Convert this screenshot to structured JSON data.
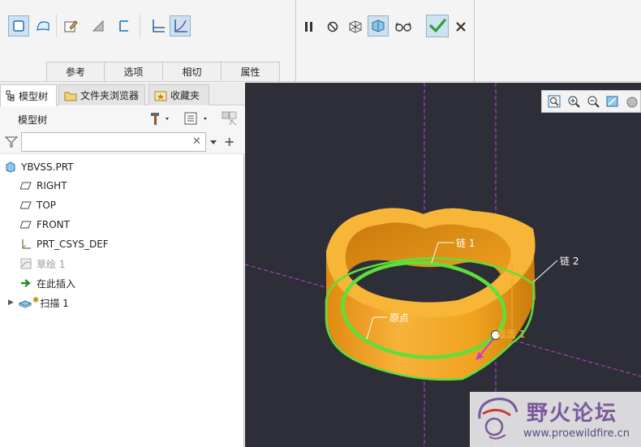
{
  "ribbon": {
    "tabs": [
      "参考",
      "选项",
      "相切",
      "属性"
    ]
  },
  "left_panel": {
    "nav_tabs": [
      "模型树",
      "文件夹浏览器",
      "收藏夹"
    ],
    "model_tree_title": "模型树",
    "search": {
      "value": "",
      "placeholder": ""
    },
    "tree_items": [
      {
        "label": "YBVSS.PRT",
        "icon": "part-icon"
      },
      {
        "label": "RIGHT",
        "icon": "datum-plane-icon"
      },
      {
        "label": "TOP",
        "icon": "datum-plane-icon"
      },
      {
        "label": "FRONT",
        "icon": "datum-plane-icon"
      },
      {
        "label": "PRT_CSYS_DEF",
        "icon": "csys-icon"
      },
      {
        "label": "草绘 1",
        "icon": "sketch-icon"
      },
      {
        "label": "在此插入",
        "icon": "insert-arrow-icon"
      },
      {
        "label": "扫描 1",
        "icon": "sweep-icon"
      }
    ]
  },
  "viewport": {
    "labels": {
      "chain1": "链 1",
      "chain2": "链 2",
      "origin": "原点",
      "section1": "截面 1"
    },
    "watermark": {
      "title": "野火论坛",
      "url": "www.proewildfire.cn"
    }
  },
  "colors": {
    "viewport_bg": "#2e2e38",
    "model_orange": "#f5a623",
    "chain_green": "#5de03a",
    "datum_magenta": "#c23fd6",
    "ok_green": "#2f9e37"
  }
}
